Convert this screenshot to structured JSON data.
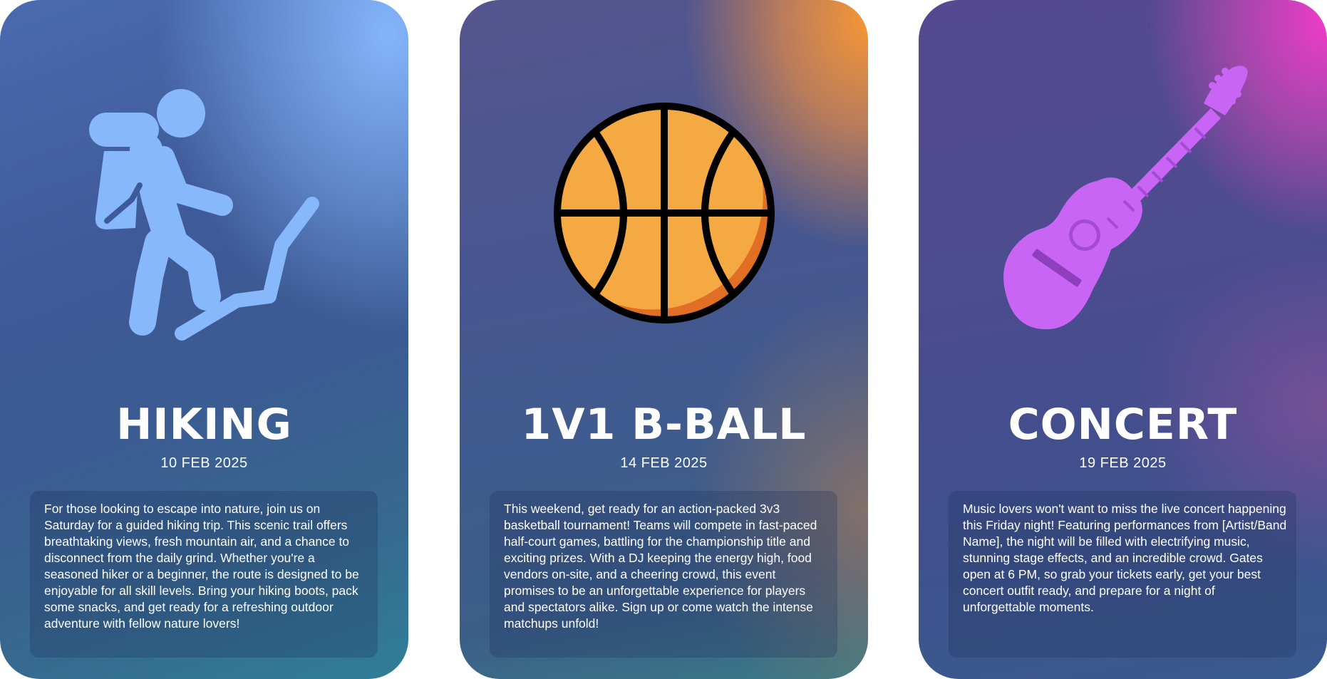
{
  "cards": [
    {
      "id": "hiking",
      "title": "HIKING",
      "date": "10 FEB 2025",
      "icon": "hiker-icon",
      "icon_color": "#86b8fb",
      "description": "For those looking to escape into nature, join us on Saturday for a guided hiking trip. This scenic trail offers breathtaking views, fresh mountain air, and a chance to disconnect from the daily grind. Whether you're a seasoned hiker or a beginner, the route is designed to be enjoyable for all skill levels. Bring your hiking boots, pack some snacks, and get ready for a refreshing outdoor adventure with fellow nature lovers!"
    },
    {
      "id": "bball",
      "title": "1V1 B-BALL",
      "date": "14 FEB 2025",
      "icon": "basketball-icon",
      "icon_color": "#f4a942",
      "description": "This weekend, get ready for an action-packed 3v3 basketball tournament! Teams will compete in fast-paced half-court games, battling for the championship title and exciting prizes. With a DJ keeping the energy high, food vendors on-site, and a cheering crowd, this event promises to be an unforgettable experience for players and spectators alike. Sign up or come watch the intense matchups unfold!"
    },
    {
      "id": "concert",
      "title": "CONCERT",
      "date": "19 FEB 2025",
      "icon": "guitar-icon",
      "icon_color": "#c865f5",
      "description": "Music lovers won't want to miss the live concert happening this Friday night! Featuring performances from [Artist/Band Name], the night will be filled with electrifying music, stunning stage effects, and an incredible crowd. Gates open at 6 PM, so grab your tickets early, get your best concert outfit ready, and prepare for a night of unforgettable moments."
    }
  ]
}
